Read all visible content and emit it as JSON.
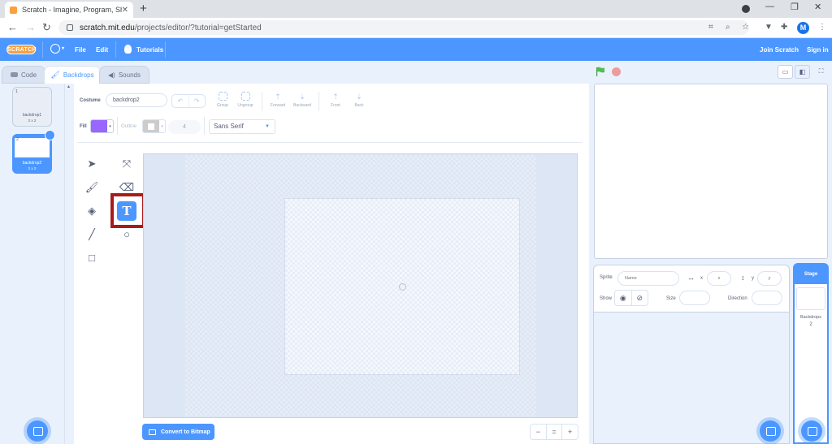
{
  "browser": {
    "tab_title": "Scratch - Imagine, Program, Shar",
    "tab_close": "✕",
    "new_tab": "+",
    "url_host": "scratch.mit.edu",
    "url_path": "/projects/editor/?tutorial=getStarted",
    "profile_initial": "M"
  },
  "menubar": {
    "logo_text": "SCRATCH",
    "file": "File",
    "edit": "Edit",
    "tutorials": "Tutorials",
    "join": "Join Scratch",
    "sign_in": "Sign in"
  },
  "editor_tabs": {
    "code": "Code",
    "backdrops": "Backdrops",
    "sounds": "Sounds"
  },
  "costumes": [
    {
      "num": "1",
      "name": "backdrop1",
      "size": "2 x 2"
    },
    {
      "num": "2",
      "name": "backdrop2",
      "size": "2 x 2"
    }
  ],
  "paint": {
    "costume_label": "Costume",
    "costume_name": "backdrop2",
    "group": "Group",
    "ungroup": "Ungroup",
    "forward": "Forward",
    "backward": "Backward",
    "front": "Front",
    "back": "Back",
    "fill_label": "Fill",
    "outline_label": "Outline",
    "outline_width": "4",
    "font": "Sans Serif",
    "text_tool_glyph": "T",
    "convert_label": "Convert to Bitmap",
    "zoom_out": "−",
    "zoom_reset": "=",
    "zoom_in": "+"
  },
  "colors": {
    "fill": "#9966ff",
    "outline": "#cccccc",
    "accent": "#4c97ff",
    "highlight": "#a71b1d"
  },
  "sprite_info": {
    "sprite_label": "Sprite",
    "name_placeholder": "Name",
    "x_label": "x",
    "x_placeholder": "x",
    "y_label": "y",
    "y_placeholder": "y",
    "show_label": "Show",
    "size_label": "Size",
    "direction_label": "Direction"
  },
  "stage_pane": {
    "header": "Stage",
    "backdrops_label": "Backdrops",
    "backdrops_count": "2"
  }
}
